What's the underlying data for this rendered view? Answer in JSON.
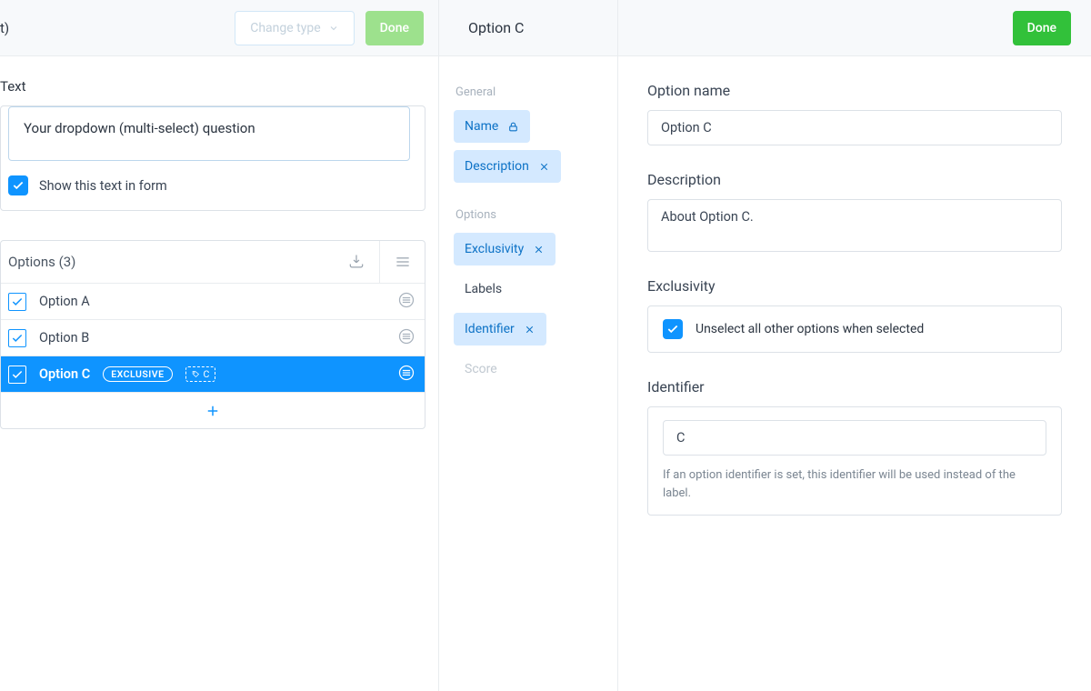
{
  "left": {
    "title_fragment": "t)",
    "change_type_label": "Change type",
    "done_label": "Done",
    "text_section_label": "Text",
    "question_text": "Your dropdown (multi-select) question",
    "show_text_label": "Show this text in form",
    "show_text_checked": true,
    "options_header": "Options (3)",
    "options": [
      {
        "label": "Option A",
        "selected": false,
        "exclusive": false,
        "identifier": null
      },
      {
        "label": "Option B",
        "selected": false,
        "exclusive": false,
        "identifier": null
      },
      {
        "label": "Option C",
        "selected": true,
        "exclusive": true,
        "identifier": "C"
      }
    ],
    "exclusive_badge": "EXCLUSIVE"
  },
  "mid": {
    "title": "Option C",
    "groups": [
      {
        "label": "General",
        "chips": [
          {
            "key": "name",
            "label": "Name",
            "icon": "lock",
            "active": true
          },
          {
            "key": "description",
            "label": "Description",
            "icon": "close",
            "active": true
          }
        ]
      },
      {
        "label": "Options",
        "chips": [
          {
            "key": "exclusivity",
            "label": "Exclusivity",
            "icon": "close",
            "active": true
          },
          {
            "key": "labels",
            "label": "Labels",
            "icon": null,
            "active": false
          },
          {
            "key": "identifier",
            "label": "Identifier",
            "icon": "close",
            "active": true
          },
          {
            "key": "score",
            "label": "Score",
            "icon": null,
            "dim": true
          }
        ]
      }
    ]
  },
  "right": {
    "done_label": "Done",
    "option_name_label": "Option name",
    "option_name_value": "Option C",
    "description_label": "Description",
    "description_value": "About Option C.",
    "exclusivity_label": "Exclusivity",
    "exclusivity_toggle_label": "Unselect all other options when selected",
    "exclusivity_checked": true,
    "identifier_label": "Identifier",
    "identifier_value": "C",
    "identifier_hint": "If an option identifier is set, this identifier will be used instead of the label."
  }
}
